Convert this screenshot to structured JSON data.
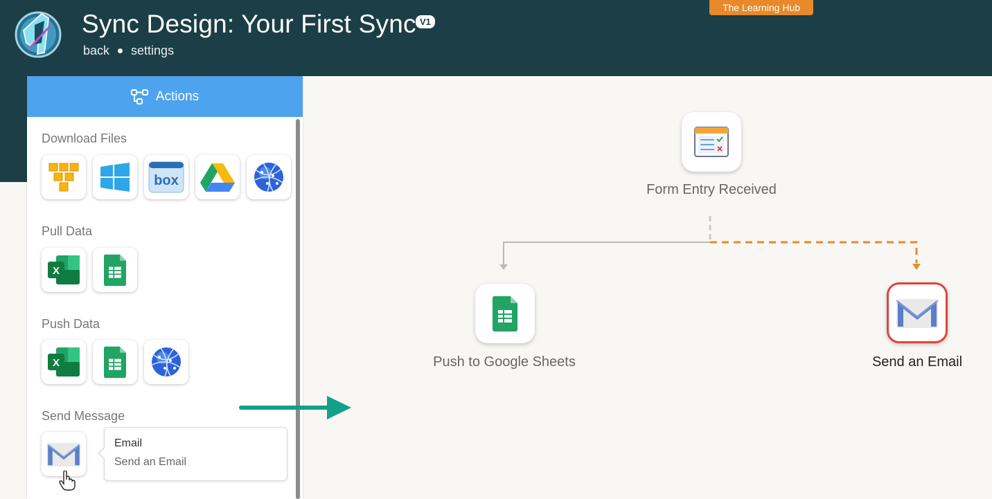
{
  "header": {
    "title": "Sync Design: Your First Sync",
    "version_badge": "V1",
    "breadcrumb_back": "back",
    "breadcrumb_settings": "settings",
    "hub_badge": "The Learning Hub"
  },
  "actions_panel": {
    "header_label": "Actions",
    "sections": {
      "download_files": {
        "title": "Download Files",
        "items": [
          "aws-s3-icon",
          "windows-icon",
          "box-icon",
          "google-drive-icon",
          "web-globe-icon"
        ]
      },
      "pull_data": {
        "title": "Pull Data",
        "items": [
          "excel-icon",
          "google-sheets-icon"
        ]
      },
      "push_data": {
        "title": "Push Data",
        "items": [
          "excel-icon",
          "google-sheets-icon",
          "web-globe-icon"
        ]
      },
      "send_message": {
        "title": "Send Message",
        "items": [
          "gmail-icon"
        ]
      }
    },
    "tooltip": {
      "title": "Email",
      "subtitle": "Send an Email"
    }
  },
  "canvas": {
    "nodes": [
      {
        "id": "trigger",
        "label": "Form Entry Received",
        "icon": "form-icon"
      },
      {
        "id": "sheets",
        "label": "Push to Google Sheets",
        "icon": "google-sheets-icon"
      },
      {
        "id": "email",
        "label": "Send an Email",
        "icon": "gmail-icon",
        "selected": true
      }
    ],
    "colors": {
      "connector_solid": "#b9b9b9",
      "connector_dashed": "#e8892b",
      "selected_border": "#e0433b",
      "annotation_arrow": "#13a08a"
    }
  },
  "colors": {
    "header_bg": "#1c3e46",
    "panel_header_bg": "#4da3ee",
    "hub_badge_bg": "#e8892b",
    "canvas_bg": "#f8f7f4"
  }
}
